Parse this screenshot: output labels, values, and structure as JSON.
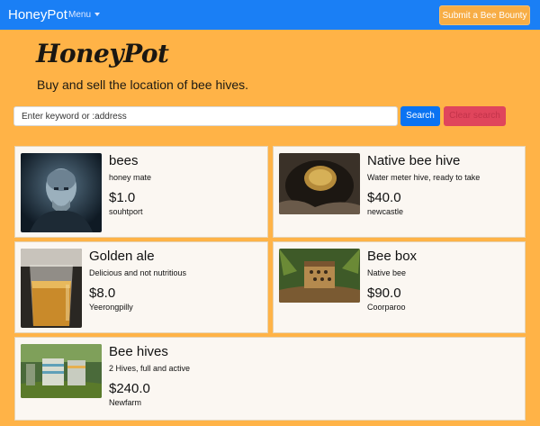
{
  "navbar": {
    "brand": "HoneyPot",
    "menu_label": "Menu",
    "bounty_button": "Submit a Bee Bounty"
  },
  "hero": {
    "logo": "HoneyPot",
    "tagline": "Buy and sell the location of bee hives."
  },
  "search": {
    "placeholder": "Enter keyword or :address",
    "search_button": "Search",
    "clear_button": "Clear search"
  },
  "listings": [
    {
      "title": "bees",
      "description": "honey mate",
      "price": "$1.0",
      "location": "souhtport",
      "image": "man-portrait"
    },
    {
      "title": "Native bee hive",
      "description": "Water meter hive, ready to take",
      "price": "$40.0",
      "location": "newcastle",
      "image": "hive-in-ground"
    },
    {
      "title": "Golden ale",
      "description": "Delicious and not nutritious",
      "price": "$8.0",
      "location": "Yeerongpilly",
      "image": "beer-glass"
    },
    {
      "title": "Bee box",
      "description": "Native bee",
      "price": "$90.0",
      "location": "Coorparoo",
      "image": "bee-box"
    },
    {
      "title": "Bee hives",
      "description": "2 Hives, full and active",
      "price": "$240.0",
      "location": "Newfarm",
      "image": "hive-boxes"
    }
  ],
  "colors": {
    "navbar": "#1a7ff5",
    "background": "#ffb347",
    "search_button": "#0a73f2",
    "clear_button": "#e0455c",
    "bounty_button": "#f7ad45"
  }
}
